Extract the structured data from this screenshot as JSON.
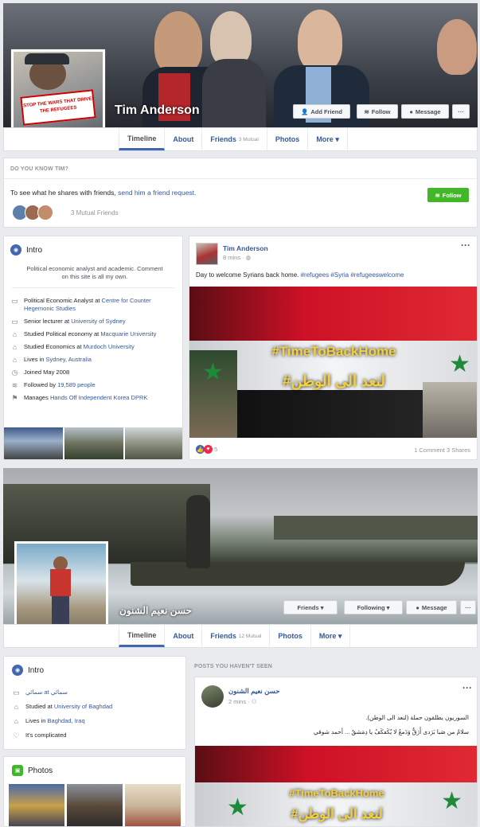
{
  "profile1": {
    "name": "Tim Anderson",
    "sign_text": "STOP THE WARS THAT DRIVE THE REFUGEES",
    "buttons": {
      "add_friend": "Add Friend",
      "follow": "Follow",
      "message": "Message",
      "more": "···"
    },
    "tabs": [
      {
        "label": "Timeline"
      },
      {
        "label": "About"
      },
      {
        "label": "Friends",
        "count": "3 Mutual"
      },
      {
        "label": "Photos"
      },
      {
        "label": "More ▾"
      }
    ],
    "know": {
      "header": "DO YOU KNOW TIM?",
      "text_prefix": "To see what he shares with friends, ",
      "link": "send him a friend request.",
      "follow_btn": "Follow",
      "mutual": "3 Mutual Friends"
    },
    "intro": {
      "title": "Intro",
      "bio": "Political economic analyst and academic. Comment on this site is all my own.",
      "items": [
        {
          "icon": "briefcase-icon",
          "text": "Political Economic Analyst at ",
          "link": "Centre for Counter Hegemonic Studies"
        },
        {
          "icon": "briefcase-icon",
          "text": "Senior lecturer at ",
          "link": "University of Sydney"
        },
        {
          "icon": "graduation-cap-icon",
          "text": "Studied Political economy at ",
          "link": "Macquarie University"
        },
        {
          "icon": "graduation-cap-icon",
          "text": "Studied Economics at ",
          "link": "Murdoch University"
        },
        {
          "icon": "home-icon",
          "text": "Lives in ",
          "link": "Sydney, Australia"
        },
        {
          "icon": "clock-icon",
          "text": "Joined May 2008",
          "link": ""
        },
        {
          "icon": "followers-icon",
          "text": "Followed by ",
          "link": "19,589 people"
        },
        {
          "icon": "flag-icon",
          "text": "Manages ",
          "link": "Hands Off Independent Korea DPRK"
        }
      ]
    },
    "post": {
      "author": "Tim Anderson",
      "time": "8 mins · ",
      "text": "Day to welcome Syrians back home. ",
      "hashtags": "#refugees #Syria #refugeeswelcome",
      "image_tag": "#TimeToBackHome",
      "image_arabic": "#لنعد الى الوطن",
      "reactions": "5",
      "comments": "1 Comment",
      "shares": "3 Shares",
      "menu": "···"
    }
  },
  "profile2": {
    "name": "حسن نعيم الشنون",
    "buttons": {
      "friends": "Friends ▾",
      "following": "Following ▾",
      "message": "Message",
      "more": "···"
    },
    "tabs": [
      {
        "label": "Timeline"
      },
      {
        "label": "About"
      },
      {
        "label": "Friends",
        "count": "12 Mutual"
      },
      {
        "label": "Photos"
      },
      {
        "label": "More ▾"
      }
    ],
    "intro": {
      "title": "Intro",
      "items": [
        {
          "icon": "briefcase-icon",
          "text": "",
          "link": "سمائي at سمائي"
        },
        {
          "icon": "graduation-cap-icon",
          "text": "Studied at ",
          "link": "University of Baghdad"
        },
        {
          "icon": "home-icon",
          "text": "Lives in ",
          "link": "Baghdad, Iraq"
        },
        {
          "icon": "heart-icon",
          "text": "It's complicated",
          "link": ""
        }
      ]
    },
    "photos": {
      "title": "Photos"
    },
    "posts_header": "POSTS YOU HAVEN'T SEEN",
    "post": {
      "author": "حسن نعيم الشنون",
      "time": "2 mins · ",
      "line1": "السوريون يطلقون حملة (لنعد الى الوطن).",
      "line2": "سلامٌ من صَبا بَرَدى أَرَقُّ وَدَمعٌ لا يُكَفكَفُ يا دِمَشقُ ... أحمد شوقي",
      "image_tag": "#TimeToBackHome",
      "image_arabic": "#لنعد الى الوطن",
      "menu": "···"
    }
  },
  "colors": {
    "link": "#365899",
    "green": "#42b72a",
    "flag_red": "#ce1126",
    "flag_black": "#000000"
  }
}
